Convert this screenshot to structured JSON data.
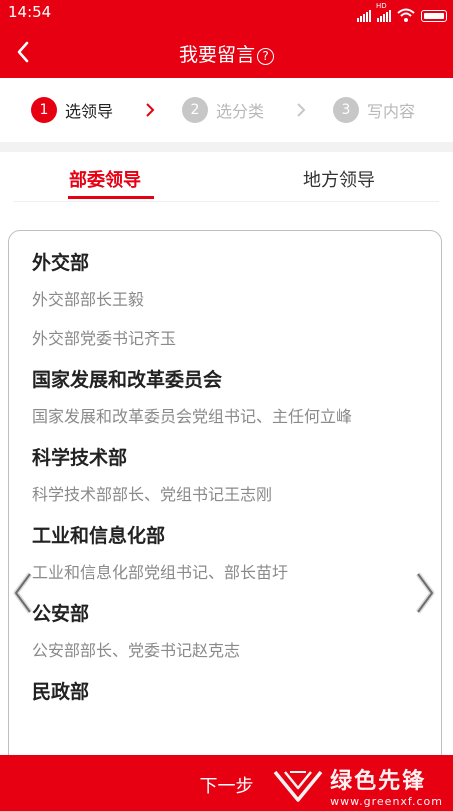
{
  "status_bar": {
    "time": "14:54",
    "hd_label": "HD",
    "signal_icons": [
      "signal-icon",
      "hd-signal-icon",
      "wifi-icon",
      "battery-icon"
    ]
  },
  "header": {
    "back_icon": "back-arrow-icon",
    "title": "我要留言",
    "help_symbol": "?"
  },
  "steps": [
    {
      "number": "1",
      "label": "选领导",
      "state": "active"
    },
    {
      "number": "2",
      "label": "选分类",
      "state": "inactive"
    },
    {
      "number": "3",
      "label": "写内容",
      "state": "inactive"
    }
  ],
  "tabs": [
    {
      "label": "部委领导",
      "selected": true
    },
    {
      "label": "地方领导",
      "selected": false
    }
  ],
  "departments": [
    {
      "name": "外交部",
      "leaders": [
        "外交部部长王毅",
        "外交部党委书记齐玉"
      ]
    },
    {
      "name": "国家发展和改革委员会",
      "leaders": [
        "国家发展和改革委员会党组书记、主任何立峰"
      ]
    },
    {
      "name": "科学技术部",
      "leaders": [
        "科学技术部部长、党组书记王志刚"
      ]
    },
    {
      "name": "工业和信息化部",
      "leaders": [
        "工业和信息化部党组书记、部长苗圩"
      ]
    },
    {
      "name": "公安部",
      "leaders": [
        "公安部部长、党委书记赵克志"
      ]
    },
    {
      "name": "民政部",
      "leaders": []
    }
  ],
  "footer": {
    "next_label": "下一步",
    "watermark_cn": "绿色先锋",
    "watermark_url": "www.greenxf.com"
  },
  "colors": {
    "brand_red": "#e60012",
    "step_inactive": "#c7c7c7",
    "text_muted": "#8a8a8a"
  }
}
